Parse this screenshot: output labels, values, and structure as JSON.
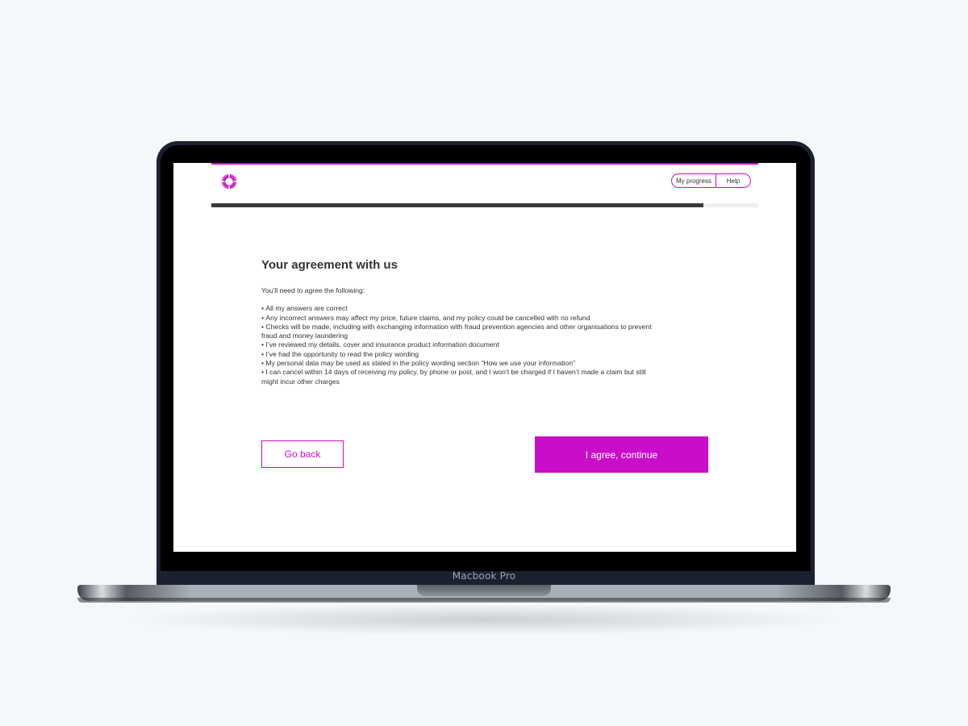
{
  "device": {
    "label": "Macbook Pro"
  },
  "header": {
    "logo_icon": "sunburst-ring-logo",
    "my_progress_label": "My progress",
    "help_label": "Help"
  },
  "progress": {
    "fraction": 0.9
  },
  "agreement": {
    "title": "Your agreement with us",
    "intro": "You’ll need to agree the following:",
    "items": [
      "All my answers are correct",
      "Any incorrect answers may affect my price, future claims, and my policy could be cancelled with no refund",
      "Checks will be made, including with exchanging information with fraud prevention agencies and other organisations to prevent fraud and money laundering",
      "I’ve reviewed my details, cover and insurance product information document",
      "I’ve had the opportunity to read the policy wording",
      "My personal data may be used as stated in the policy wording section “How we use your information”",
      "I can cancel within 14 days of receiving my policy, by phone or post, and I won’t be charged if I haven’t made a claim but still might incur other charges"
    ]
  },
  "actions": {
    "back_label": "Go back",
    "agree_label": "I agree, continue"
  },
  "colors": {
    "accent": "#c90ec9",
    "progress_fill": "#3c3c3c",
    "text": "#333333",
    "page_background": "#f5f8fb"
  }
}
